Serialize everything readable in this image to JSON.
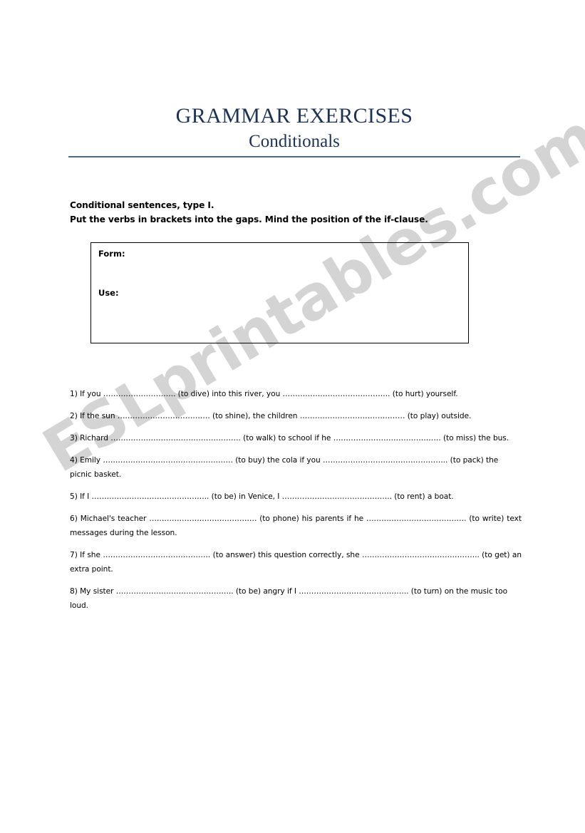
{
  "document": {
    "title": "GRAMMAR EXERCISES",
    "subtitle": "Conditionals",
    "title_color": "#1c3252",
    "rule_color": "#4a6c8a"
  },
  "instructions": {
    "heading": "Conditional sentences, type I.",
    "task": "Put the verbs in brackets into the gaps. Mind the position of the if-clause."
  },
  "notes_box": {
    "form_label": "Form:",
    "use_label": "Use:",
    "form_value": "",
    "use_value": ""
  },
  "exercises": [
    {
      "number": "1)",
      "text": "1) If you ……………………….. (to dive) into this river, you ……………………………………. (to hurt) yourself.",
      "justified": false
    },
    {
      "number": "2)",
      "text": "2) If the sun ………………………………. (to shine), the children …………………………………… (to play) outside.",
      "justified": false
    },
    {
      "number": "3)",
      "text": "3) Richard ……………………………………………. (to walk) to school if he ……………………………………. (to miss) the bus.",
      "justified": false
    },
    {
      "number": "4)",
      "text": "4) Emily ……………………………………………. (to buy) the cola if you ………………………………………….. (to pack) the picnic basket.",
      "justified": false
    },
    {
      "number": "5)",
      "text": "5) If I ……………………………………….. (to be) in Venice, I …………………………………….. (to rent) a boat.",
      "justified": false
    },
    {
      "number": "6)",
      "text": "6) Michael's teacher ……………………………………. (to phone) his parents if he …………………………………. (to write) text messages during the lesson.",
      "justified": true
    },
    {
      "number": "7)",
      "text": "7) If she ……………………………………. (to answer) this question correctly, she ……………………………………….. (to get) an extra point.",
      "justified": true
    },
    {
      "number": "8)",
      "text": "8) My sister ……………………………………….. (to be) angry if I …………………………………….. (to turn) on the music too loud.",
      "justified": false
    }
  ],
  "watermark": {
    "text": "ESLprintables.com",
    "color": "#d4d4d4"
  }
}
